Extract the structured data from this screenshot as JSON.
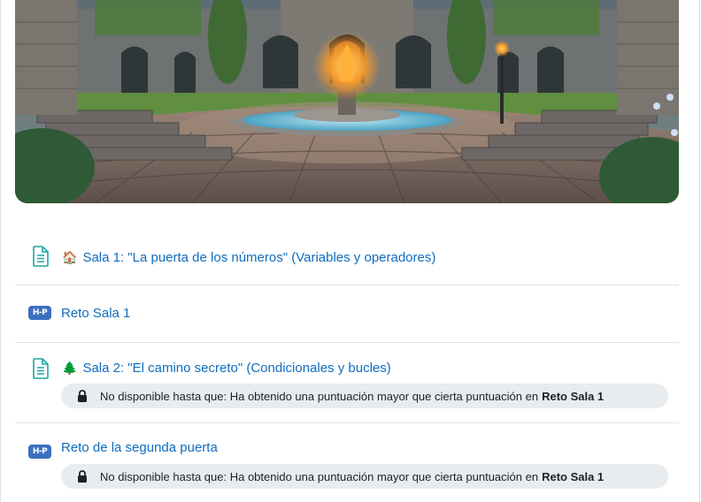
{
  "banner": {
    "alt": "Ilustración de un patio de castillo con una fuente de fuego"
  },
  "activities": [
    {
      "icon": "page-icon",
      "emoji": "🏠",
      "title": "Sala 1: \"La puerta de los números\" (Variables y operadores)"
    },
    {
      "icon": "h5p-icon",
      "badge": "H-P",
      "title": "Reto Sala 1"
    },
    {
      "icon": "page-icon",
      "emoji": "🌲",
      "title": "Sala 2: \"El camino secreto\" (Condicionales y bucles)",
      "restriction": {
        "text": "No disponible hasta que: Ha obtenido una puntuación mayor que cierta puntuación en",
        "target": "Reto Sala 1"
      }
    },
    {
      "icon": "h5p-icon",
      "badge": "H-P",
      "title": "Reto de la segunda puerta",
      "restriction": {
        "text": "No disponible hasta que: Ha obtenido una puntuación mayor que cierta puntuación en",
        "target": "Reto Sala 1"
      }
    }
  ],
  "colors": {
    "link": "#0f6cbf",
    "page_icon": "#1ea5a5",
    "h5p_badge": "#3b6fbf",
    "restriction_bg": "#e9ecef",
    "divider": "#dee2e6"
  }
}
